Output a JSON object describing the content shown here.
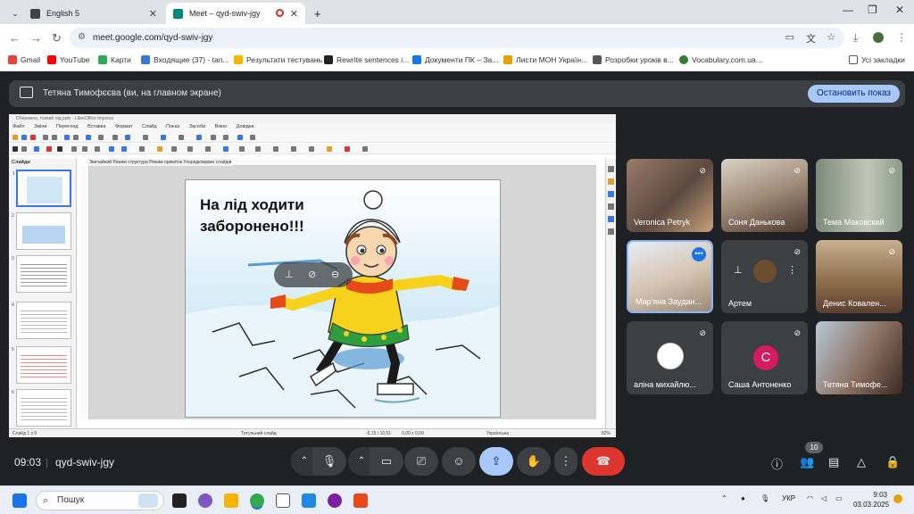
{
  "browser": {
    "tabs": [
      {
        "title": "English 5",
        "active": false
      },
      {
        "title": "Meet – qyd-swiv-jgy",
        "active": true
      }
    ],
    "url": "meet.google.com/qyd-swiv-jgy",
    "bookmarks": [
      "Gmail",
      "YouTube",
      "Карти",
      "Вхoдящие (37) - tan...",
      "Результати тестувань",
      "Rewrite sentences i...",
      "Документи ПК – За...",
      "Листи МОН Україн...",
      "Розробки уроків в...",
      "Vocabulary.com.ua..."
    ],
    "all_bookmarks": "Усі закладки"
  },
  "meet": {
    "banner_text": "Тетяна Тимофєєва (ви, на главном экране)",
    "stop_button": "Остановить показ",
    "time": "09:03",
    "meeting_code": "qyd-swiv-jgy",
    "participants_count": "10",
    "participants": [
      {
        "name": "Veronica Petryk",
        "muted": true
      },
      {
        "name": "Соня Данькова",
        "muted": true
      },
      {
        "name": "Тема Маковский",
        "muted": true
      },
      {
        "name": "Мар'яна Заудан...",
        "muted": false,
        "speaking": true
      },
      {
        "name": "Артем",
        "muted": true
      },
      {
        "name": "Денис Ковален...",
        "muted": true
      },
      {
        "name": "аліна михайлю...",
        "muted": true
      },
      {
        "name": "Саша Антоненко",
        "muted": true,
        "initial": "С"
      },
      {
        "name": "Тетяна Тимофе...",
        "muted": false
      }
    ]
  },
  "presentation": {
    "window_title": "Обережно, тонкий лід.pptx - LibreOffice Impress",
    "menu": [
      "Файл",
      "Зміни",
      "Перегляд",
      "Вставка",
      "Формат",
      "Слайд",
      "Показ",
      "Засоби",
      "Вікно",
      "Довідка"
    ],
    "panel_title": "Слайди",
    "view_modes": "Звичайний  Режим структури  Режим приміток  Упорядковувач слайдів",
    "slide_text": "На лід ходити заборонено!!!",
    "status_slide": "Слайд 1 з 9",
    "status_layout": "Титульний слайд",
    "status_coords": "-5,15 / 10,51",
    "status_size": "0,00 x 0,00",
    "status_lang": "Українська",
    "status_zoom": "82%",
    "thumb_numbers": [
      "1",
      "2",
      "3",
      "4",
      "5",
      "6"
    ]
  },
  "taskbar": {
    "search_placeholder": "Пошук",
    "lang": "УКР",
    "time": "9:03",
    "date": "03.03.2025"
  }
}
